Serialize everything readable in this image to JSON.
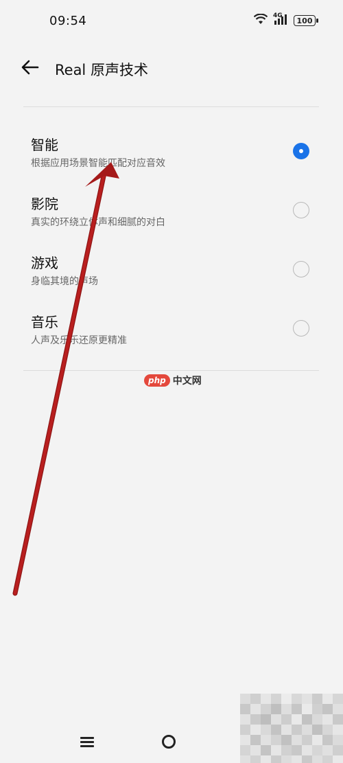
{
  "status_bar": {
    "time": "09:54",
    "network": "4G",
    "battery": "100"
  },
  "header": {
    "title": "Real 原声技术",
    "back_icon": "arrow-left-icon"
  },
  "options": [
    {
      "title": "智能",
      "subtitle": "根据应用场景智能匹配对应音效",
      "selected": true
    },
    {
      "title": "影院",
      "subtitle": "真实的环绕立体声和细腻的对白",
      "selected": false
    },
    {
      "title": "游戏",
      "subtitle": "身临其境的声场",
      "selected": false
    },
    {
      "title": "音乐",
      "subtitle": "人声及乐乐还原更精准",
      "selected": false
    }
  ],
  "watermark": {
    "badge": "php",
    "text": "中文网"
  },
  "colors": {
    "accent": "#1a73e8",
    "annotation_arrow": "#b01c1c",
    "background": "#f3f3f3"
  },
  "nav": {
    "menu_icon": "menu-icon",
    "home_icon": "home-circle-icon"
  }
}
